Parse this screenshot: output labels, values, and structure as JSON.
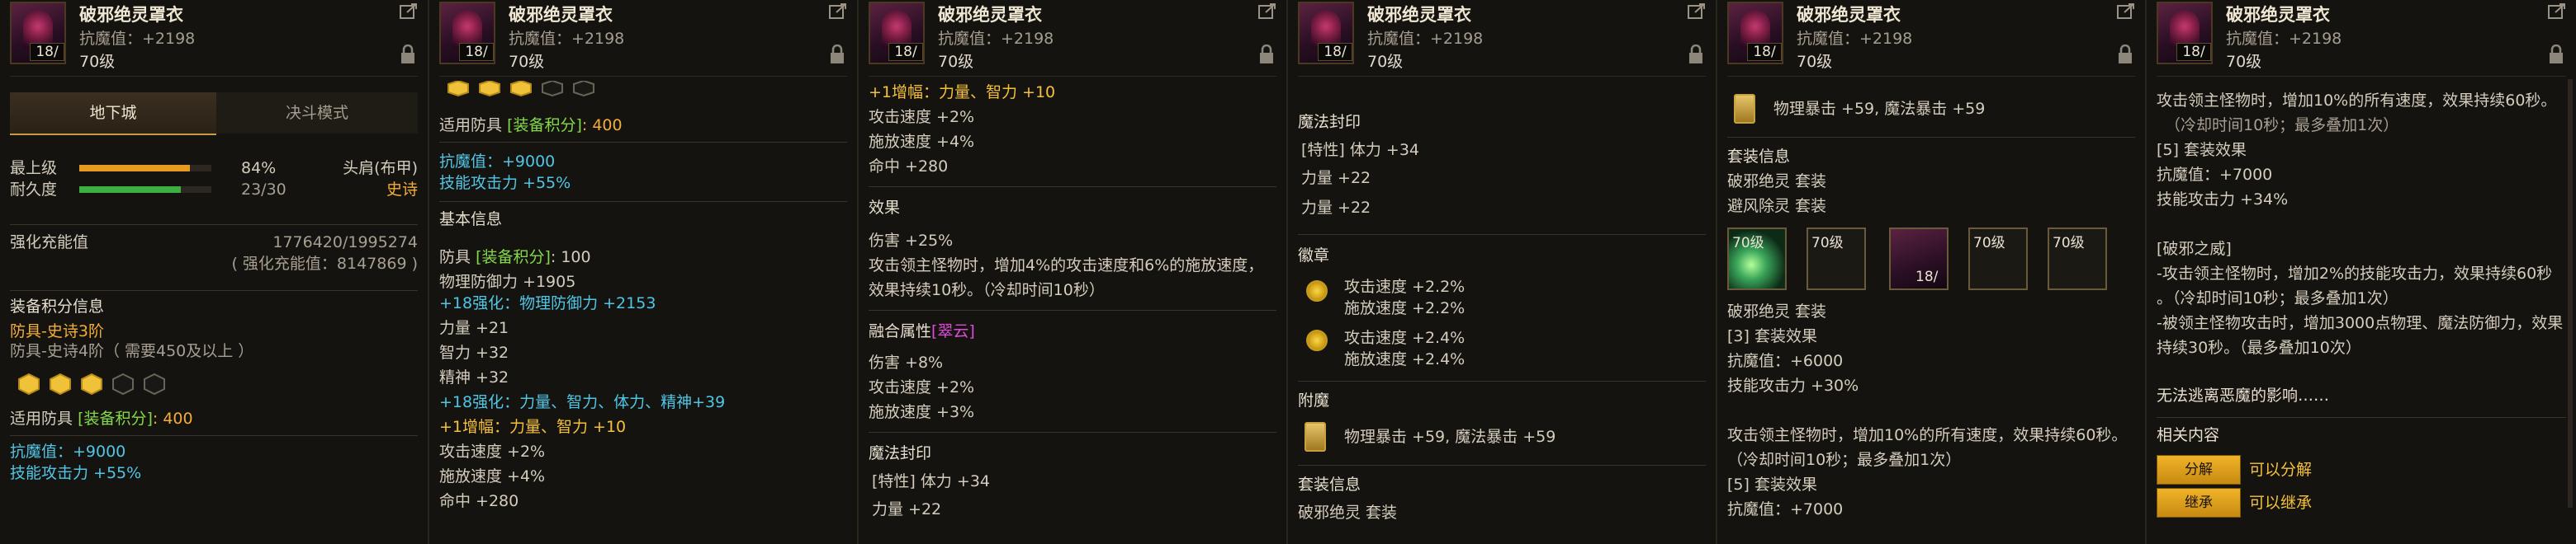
{
  "common": {
    "item_name": "破邪绝灵罩衣",
    "anti_magic": "抗魔值：+2198",
    "level": "70级",
    "count": "18/",
    "badge": "",
    "colors": {
      "cyan": "#4fc6e6",
      "gold": "#f5c13b",
      "orange": "#f2ad3a",
      "green": "#84d94a",
      "magenta": "#e04ad9"
    }
  },
  "p1": {
    "tab_active": "地下城",
    "tab_other": "决斗模式",
    "top_label": "最上级",
    "top_percent": "84%",
    "top_progress": 0.84,
    "slot": "头肩(布甲)",
    "rarity": "史诗",
    "durability_label": "耐久度",
    "durability_value": "23/30",
    "durability_progress": 0.77,
    "enhance_label": "强化充能值",
    "enhance_value": "1776420/1995274",
    "enhance_sub": "( 强化充能值：8147869 )",
    "gear_score_title": "装备积分信息",
    "armor_line1": "防具-史诗3阶",
    "armor_line2": "防具-史诗4阶（ 需要450及以上 ）",
    "applicable_label": "适用防具",
    "gear_score_tag": "[装备积分]",
    "gear_score_value": ": 400",
    "anti_magic_bonus": "抗魔值：+9000",
    "skill_attack": "技能攻击力 +55%"
  },
  "p2": {
    "applicable": "适用防具",
    "gear_score_tag": "[装备积分]",
    "gear_score_value": ": 400",
    "anti_magic_bonus": "抗魔值：+9000",
    "skill_attack": "技能攻击力 +55%",
    "base_info": "基本信息",
    "armor_gs_label": "防具",
    "armor_gs_tag": "[装备积分]",
    "armor_gs_value": ": 100",
    "phys_def": "物理防御力 +1905",
    "enh_phys": "+18强化：物理防御力 +2153",
    "str": "力量 +21",
    "int": "智力 +32",
    "spi": "精神 +32",
    "enh_stats": "+18强化：力量、智力、体力、精神+39",
    "amp": "+1增幅：力量、智力 +10",
    "atk_speed": "攻击速度 +2%",
    "cast_speed": "施放速度 +4%",
    "hit": "命中 +280"
  },
  "p3": {
    "amp": "+1增幅：力量、智力 +10",
    "atk_speed": "攻击速度 +2%",
    "cast_speed": "施放速度 +4%",
    "hit": "命中 +280",
    "effect": "效果",
    "damage": "伤害 +25%",
    "effect_desc1": "攻击领主怪物时，增加4%的攻击速度和6%的施放速度，",
    "effect_desc2": "效果持续10秒。（冷却时间10秒）",
    "fusion_label": "融合属性",
    "fusion_tag": "[翠云]",
    "dmg8": "伤害 +8%",
    "atk2": "攻击速度 +2%",
    "cast3": "施放速度 +3%",
    "seal": "魔法封印",
    "seal_line": "[特性] 体力 +34",
    "str22": "力量 +22"
  },
  "p4": {
    "seal": "魔法封印",
    "seal_line": "[特性] 体力 +34",
    "str22a": "力量 +22",
    "str22b": "力量 +22",
    "emblem": "徽章",
    "e1a": "攻击速度 +2.2%",
    "e1b": "施放速度 +2.2%",
    "e2a": "攻击速度 +2.4%",
    "e2b": "施放速度 +2.4%",
    "enchant": "附魔",
    "enchant_line": "物理暴击 +59, 魔法暴击 +59",
    "set_info": "套装信息",
    "set_line": "破邪绝灵  套装"
  },
  "p5": {
    "enchant_line": "物理暴击 +59, 魔法暴击 +59",
    "set_info": "套装信息",
    "set1": "破邪绝灵  套装",
    "set2": "避风除灵  套装",
    "cards": [
      "70级",
      "70级",
      "18/",
      "70级",
      "70级"
    ],
    "set_name": "破邪绝灵  套装",
    "set3": "[3] 套装效果",
    "am6000": "抗魔值：+6000",
    "skill30": "技能攻击力 +30%",
    "desc1": "攻击领主怪物时，增加10%的所有速度，效果持续60秒。",
    "desc2": "（冷却时间10秒；最多叠加1次）",
    "set5": "[5] 套装效果",
    "am7000": "抗魔值：+7000"
  },
  "p6": {
    "desc1": "攻击领主怪物时，增加10%的所有速度，效果持续60秒。",
    "desc2": "（冷却时间10秒；最多叠加1次）",
    "set5": "[5] 套装效果",
    "am7000": "抗魔值：+7000",
    "skill34": "技能攻击力 +34%",
    "power_title": "[破邪之威]",
    "power1": "-攻击领主怪物时，增加2%的技能攻击力，效果持续60秒",
    "power2": "。（冷却时间10秒；最多叠加1次）",
    "power3": "-被领主怪物攻击时，增加3000点物理、魔法防御力，效果",
    "power4": "持续30秒。（最多叠加10次）",
    "flavor": "无法逃离恶魔的影响……",
    "related": "相关内容",
    "btn_decompose": "分解",
    "btn_decompose_note": "可以分解",
    "btn_inherit": "继承",
    "btn_inherit_note": "可以继承"
  }
}
